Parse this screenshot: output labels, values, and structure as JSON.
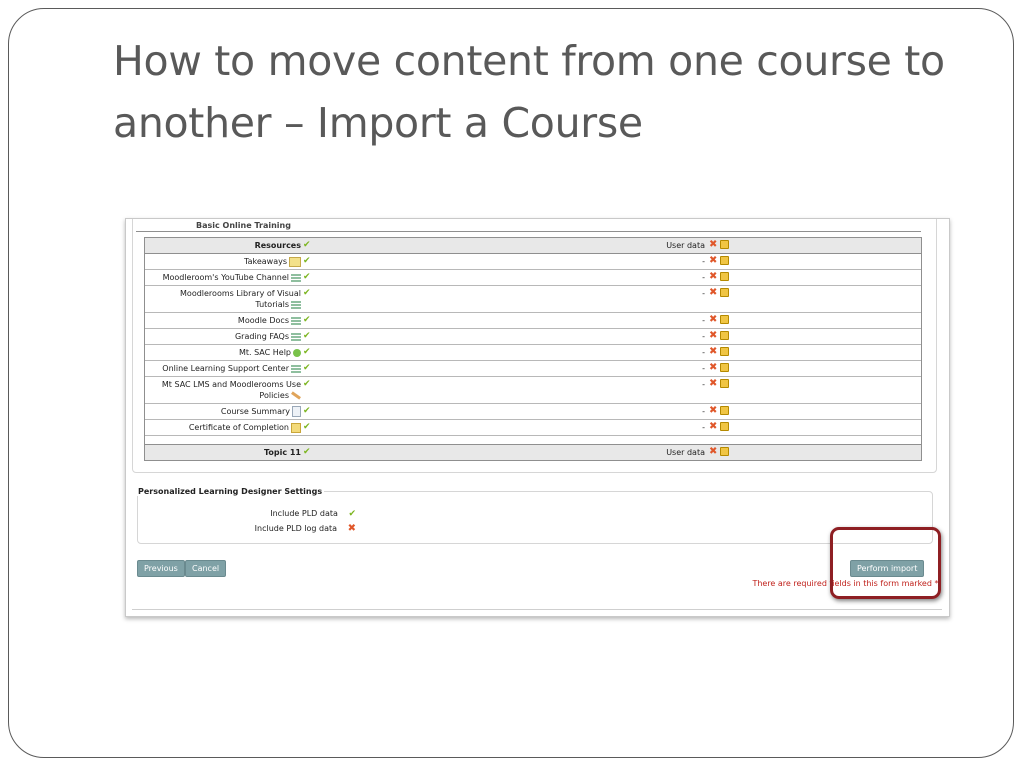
{
  "slide": {
    "title": "How to move content from one course to another – Import a Course"
  },
  "screenshot": {
    "cut_row_label": "Basic Online Training",
    "sections": [
      {
        "label": "Resources",
        "included": true,
        "user_data_label": "User data",
        "user_data_included": false,
        "items": [
          {
            "label": "Takeaways",
            "icon": "note-icon",
            "user_data": "-"
          },
          {
            "label": "Moodleroom's YouTube Channel",
            "icon": "page-icon",
            "user_data": "-"
          },
          {
            "label": "Moodlerooms Library of Visual Tutorials",
            "icon": "page-icon",
            "user_data": "-"
          },
          {
            "label": "Moodle Docs",
            "icon": "page-icon",
            "user_data": "-"
          },
          {
            "label": "Grading FAQs",
            "icon": "page-icon",
            "user_data": "-"
          },
          {
            "label": "Mt. SAC Help",
            "icon": "globe-icon",
            "user_data": "-"
          },
          {
            "label": "Online Learning Support Center",
            "icon": "page-icon",
            "user_data": "-"
          },
          {
            "label": "Mt SAC LMS and Moodlerooms Use Policies",
            "icon": "pencil-icon",
            "user_data": "-"
          },
          {
            "label": "Course Summary",
            "icon": "document-icon",
            "user_data": "-"
          },
          {
            "label": "Certificate of Completion",
            "icon": "certificate-icon",
            "user_data": "-"
          }
        ]
      },
      {
        "label": "Topic 11",
        "included": true,
        "user_data_label": "User data",
        "user_data_included": false,
        "items": []
      }
    ],
    "pld": {
      "legend": "Personalized Learning Designer Settings",
      "include_pld_data_label": "Include PLD data",
      "include_pld_data": true,
      "include_pld_log_label": "Include PLD log data",
      "include_pld_log": false
    },
    "buttons": {
      "previous": "Previous",
      "cancel": "Cancel",
      "perform_import": "Perform import"
    },
    "required_note": "There are required fields in this form marked *.",
    "colors": {
      "check": "#7cb520",
      "cross": "#e0572a",
      "button": "#7fa1a6",
      "required_text": "#c0221c",
      "highlight_border": "#8e1f23"
    }
  }
}
